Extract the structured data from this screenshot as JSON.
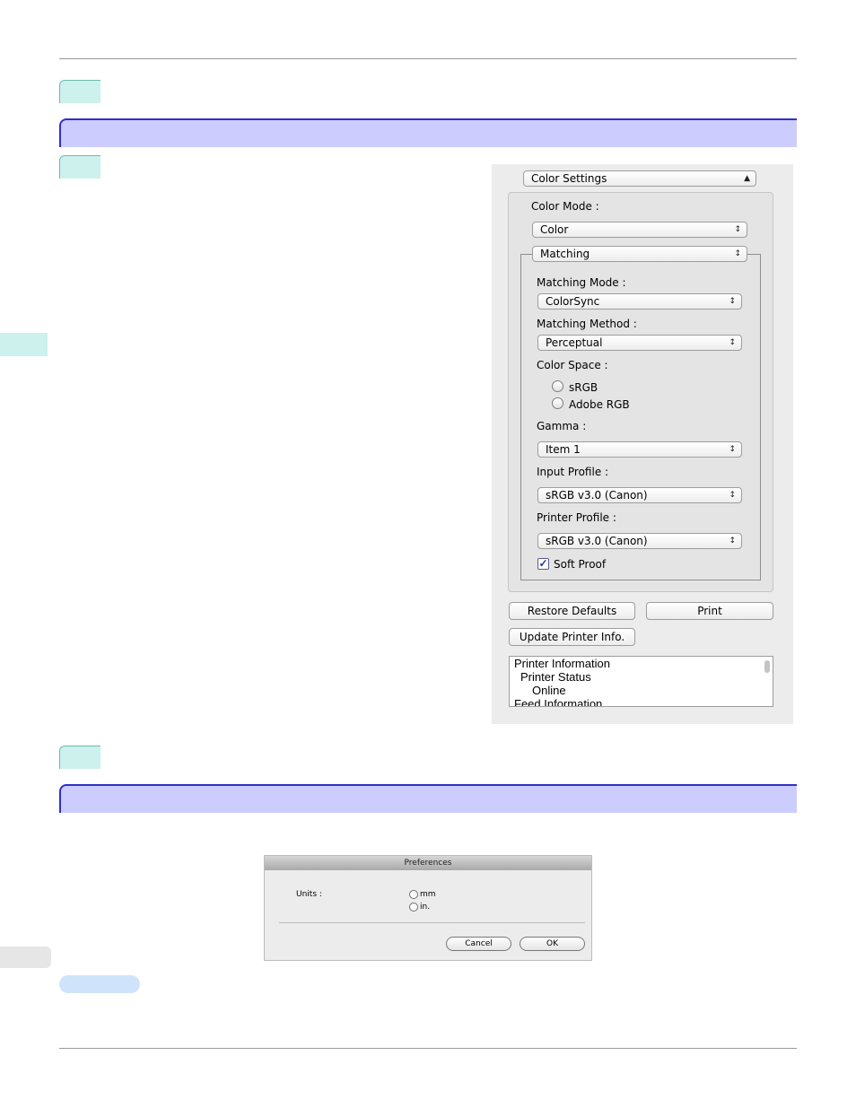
{
  "color_settings": {
    "section_select": "Color Settings",
    "color_mode_label": "Color Mode :",
    "color_mode_value": "Color",
    "matching_select": "Matching",
    "matching_mode_label": "Matching Mode :",
    "matching_mode_value": "ColorSync",
    "matching_method_label": "Matching Method :",
    "matching_method_value": "Perceptual",
    "color_space_label": "Color Space :",
    "color_space_options": [
      "sRGB",
      "Adobe RGB"
    ],
    "gamma_label": "Gamma :",
    "gamma_value": "Item 1",
    "input_profile_label": "Input Profile :",
    "input_profile_value": "sRGB v3.0 (Canon)",
    "printer_profile_label": "Printer Profile :",
    "printer_profile_value": "sRGB v3.0 (Canon)",
    "soft_proof_label": "Soft Proof",
    "soft_proof_checked": true,
    "restore_defaults_label": "Restore Defaults",
    "print_label": "Print",
    "update_printer_info_label": "Update Printer Info.",
    "info_lines": [
      "Printer Information",
      "Printer Status",
      "Online",
      "Feed Information"
    ]
  },
  "preferences": {
    "title": "Preferences",
    "units_label": "Units :",
    "unit_options": [
      "mm",
      "in."
    ],
    "cancel_label": "Cancel",
    "ok_label": "OK"
  },
  "colors": {
    "section_bar": "#ccccff",
    "section_border": "#3030c8",
    "step_tab": "#cdf1ec",
    "note_pill": "#cfe4fb"
  }
}
